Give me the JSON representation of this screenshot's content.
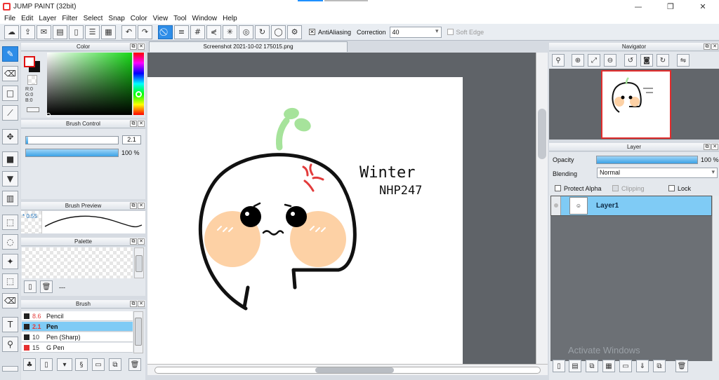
{
  "app": {
    "title": "JUMP PAINT (32bit)",
    "window_controls": [
      "—",
      "❐",
      "✕"
    ]
  },
  "menu": [
    "File",
    "Edit",
    "Layer",
    "Filter",
    "Select",
    "Snap",
    "Color",
    "View",
    "Tool",
    "Window",
    "Help"
  ],
  "toolbar": {
    "antialiasing_label": "AntiAliasing",
    "correction_label": "Correction",
    "correction_value": "40",
    "soft_edge_label": "Soft Edge"
  },
  "color_panel": {
    "title": "Color",
    "foreground": "#e01010",
    "background": "#111111",
    "rgb": [
      "R:0",
      "G:0",
      "B:0"
    ]
  },
  "brush_control": {
    "title": "Brush Control",
    "size_value": "2.1",
    "size_fraction": 0.02,
    "opacity_value": "100 %",
    "opacity_fraction": 1.0
  },
  "brush_preview": {
    "title": "Brush Preview",
    "size_label": "* 0.55"
  },
  "palette": {
    "title": "Palette",
    "name": "---"
  },
  "brush_list": {
    "title": "Brush",
    "items": [
      {
        "size": "8.6",
        "name": "Pencil",
        "color": "#222222",
        "selected": false
      },
      {
        "size": "2.1",
        "name": "Pen",
        "color": "#222222",
        "selected": true
      },
      {
        "size": "10",
        "name": "Pen (Sharp)",
        "color": "#222222",
        "selected": false
      },
      {
        "size": "15",
        "name": "G Pen",
        "color": "#e53030",
        "selected": false
      }
    ]
  },
  "canvas": {
    "tab_title": "Screenshot 2021-10-02 175015.png",
    "signature_text": [
      "Winter",
      "NHP247"
    ]
  },
  "navigator": {
    "title": "Navigator"
  },
  "layer_panel": {
    "title": "Layer",
    "opacity_label": "Opacity",
    "opacity_value": "100 %",
    "opacity_fraction": 1.0,
    "blending_label": "Blending",
    "blending_value": "Normal",
    "protect_alpha_label": "Protect Alpha",
    "clipping_label": "Clipping",
    "lock_label": "Lock",
    "layers": [
      {
        "name": "Layer1",
        "selected": true
      }
    ]
  },
  "watermark": "Activate Windows",
  "colors": {
    "accent": "#2e8de8",
    "selection": "#7fcbf5",
    "canvas_bg": "#5f6368"
  }
}
